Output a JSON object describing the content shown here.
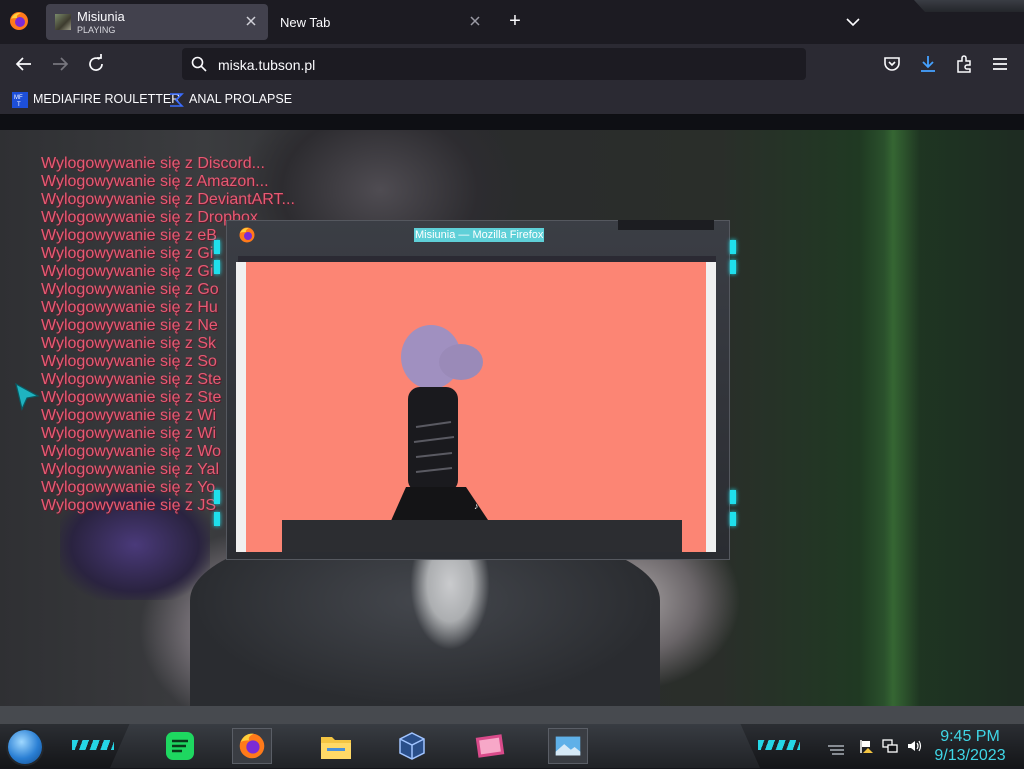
{
  "browser": {
    "tabs": [
      {
        "title": "Misiunia",
        "status": "PLAYING",
        "active": true
      },
      {
        "title": "New Tab",
        "active": false
      }
    ],
    "new_tab_glyph": "+",
    "address": "miska.tubson.pl",
    "bookmarks": [
      {
        "label": "MEDIAFIRE ROULETTER",
        "icon": "mediafire-icon"
      },
      {
        "label": "ANAL PROLAPSE",
        "icon": "sigma-icon"
      }
    ]
  },
  "page": {
    "logout_lines": [
      "Wylogowywanie się z Discord...",
      "Wylogowywanie się z Amazon...",
      "Wylogowywanie się z DeviantART...",
      "Wylogowywanie się z Dropbox",
      "Wylogowywanie się z eB",
      "Wylogowywanie się z Gi",
      "Wylogowywanie się z Gi",
      "Wylogowywanie się z Go",
      "Wylogowywanie się z Hu",
      "Wylogowywanie się z Ne",
      "Wylogowywanie się z Sk",
      "Wylogowywanie się z So",
      "Wylogowywanie się z Ste",
      "Wylogowywanie się z Ste",
      "Wylogowywanie się z Wi",
      "Wylogowywanie się z Wi",
      "Wylogowywanie się z Wo",
      "Wylogowywanie się z Yal",
      "Wylogowywanie się z Yo",
      "Wylogowywanie się z JS"
    ],
    "text_color": "#e65a73"
  },
  "popup": {
    "title": "Misiunia — Mozilla Firefox",
    "video_color": "#fc8574",
    "accent": "#1fe0ec"
  },
  "taskbar": {
    "apps": [
      "spotify-icon",
      "firefox-icon",
      "file-explorer-icon",
      "virtualbox-icon",
      "media-app-icon",
      "photos-icon"
    ],
    "time": "9:45 PM",
    "date": "9/13/2023",
    "accent": "#3fd6e6"
  }
}
